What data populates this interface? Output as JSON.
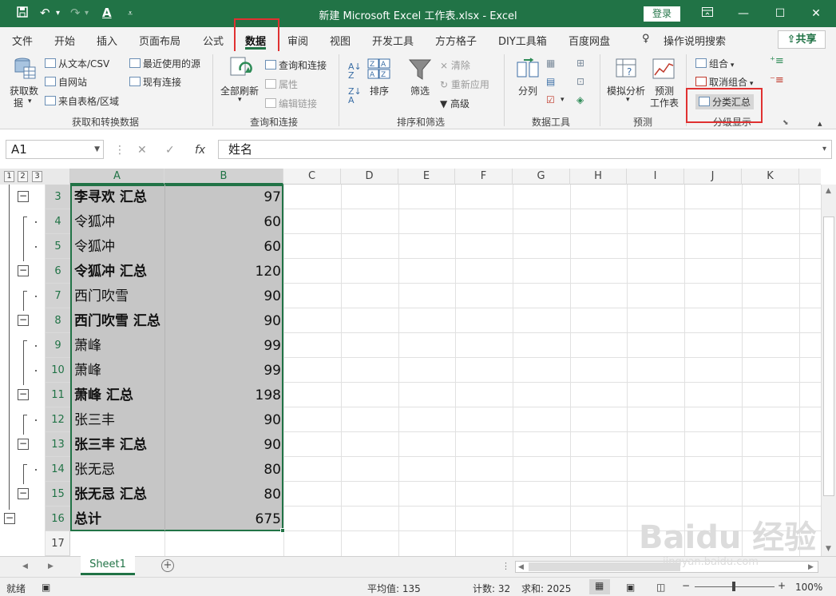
{
  "titlebar": {
    "save_icon": "save-icon",
    "undo_icon": "undo-icon",
    "redo_icon": "redo-icon",
    "font_color_icon": "font-color-icon",
    "title": "新建 Microsoft Excel 工作表.xlsx  -  Excel",
    "login": "登录",
    "accent": "#217346"
  },
  "tabs": [
    "文件",
    "开始",
    "插入",
    "页面布局",
    "公式",
    "数据",
    "审阅",
    "视图",
    "开发工具",
    "方方格子",
    "DIY工具箱",
    "百度网盘"
  ],
  "active_tab": "数据",
  "tell_me": "操作说明搜索",
  "share": "共享",
  "ribbon": {
    "get_data": "获取数",
    "get_data2": "据",
    "from_text_csv": "从文本/CSV",
    "from_web": "自网站",
    "from_table": "来自表格/区域",
    "recent_sources": "最近使用的源",
    "existing_connections": "现有连接",
    "group_get": "获取和转换数据",
    "refresh_all": "全部刷新",
    "queries_connections": "查询和连接",
    "properties": "属性",
    "edit_links": "编辑链接",
    "group_query": "查询和连接",
    "sort": "排序",
    "filter": "筛选",
    "clear": "清除",
    "reapply": "重新应用",
    "advanced": "高级",
    "group_sort": "排序和筛选",
    "text_to_columns": "分列",
    "group_tools": "数据工具",
    "what_if": "模拟分析",
    "forecast_sheet": "预测",
    "forecast_sheet2": "工作表",
    "group_forecast": "预测",
    "group": "组合",
    "ungroup": "取消组合",
    "subtotal": "分类汇总",
    "group_outline": "分级显示"
  },
  "formula_bar": {
    "name_box": "A1",
    "content": "姓名",
    "fx": "fx"
  },
  "outline_levels": [
    "1",
    "2",
    "3"
  ],
  "columns": [
    "A",
    "B",
    "C",
    "D",
    "E",
    "F",
    "G",
    "H",
    "I",
    "J",
    "K"
  ],
  "rows": [
    {
      "num": "3",
      "name": "李寻欢 汇总",
      "value": "97",
      "bold": true
    },
    {
      "num": "4",
      "name": "令狐冲",
      "value": "60",
      "bold": false
    },
    {
      "num": "5",
      "name": "令狐冲",
      "value": "60",
      "bold": false
    },
    {
      "num": "6",
      "name": "令狐冲 汇总",
      "value": "120",
      "bold": true
    },
    {
      "num": "7",
      "name": "西门吹雪",
      "value": "90",
      "bold": false
    },
    {
      "num": "8",
      "name": "西门吹雪 汇总",
      "value": "90",
      "bold": true
    },
    {
      "num": "9",
      "name": "萧峰",
      "value": "99",
      "bold": false
    },
    {
      "num": "10",
      "name": "萧峰",
      "value": "99",
      "bold": false
    },
    {
      "num": "11",
      "name": "萧峰 汇总",
      "value": "198",
      "bold": true
    },
    {
      "num": "12",
      "name": "张三丰",
      "value": "90",
      "bold": false
    },
    {
      "num": "13",
      "name": "张三丰 汇总",
      "value": "90",
      "bold": true
    },
    {
      "num": "14",
      "name": "张无忌",
      "value": "80",
      "bold": false
    },
    {
      "num": "15",
      "name": "张无忌 汇总",
      "value": "80",
      "bold": true
    },
    {
      "num": "16",
      "name": "总计",
      "value": "675",
      "bold": true
    },
    {
      "num": "17",
      "name": "",
      "value": "",
      "bold": false
    }
  ],
  "sheet_tab": "Sheet1",
  "status": {
    "ready": "就绪",
    "average": "平均值: 135",
    "count": "计数: 32",
    "sum": "求和: 2025",
    "zoom": "100%"
  },
  "watermark": {
    "main": "Baidu 经验",
    "sub": "jingyan.baidu.com"
  }
}
